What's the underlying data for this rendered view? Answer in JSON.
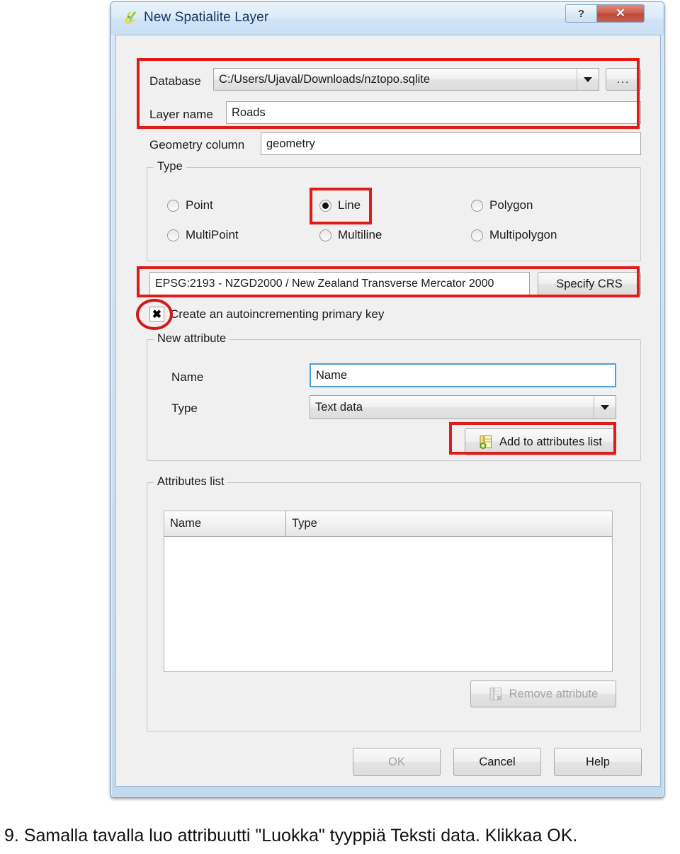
{
  "window": {
    "title": "New Spatialite Layer",
    "app_icon": "qgis-layer-icon",
    "help_button": "?",
    "close_button": "✕"
  },
  "form": {
    "database_label": "Database",
    "database_value": "C:/Users/Ujaval/Downloads/nztopo.sqlite",
    "browse_button": "...",
    "layer_name_label": "Layer name",
    "layer_name_value": "Roads",
    "geometry_column_label": "Geometry column",
    "geometry_column_value": "geometry"
  },
  "type_group": {
    "title": "Type",
    "options": [
      {
        "label": "Point",
        "checked": false
      },
      {
        "label": "Line",
        "checked": true
      },
      {
        "label": "Polygon",
        "checked": false
      },
      {
        "label": "MultiPoint",
        "checked": false
      },
      {
        "label": "Multiline",
        "checked": false
      },
      {
        "label": "Multipolygon",
        "checked": false
      }
    ]
  },
  "crs": {
    "value": "EPSG:2193 - NZGD2000 / New Zealand Transverse Mercator 2000",
    "specify_button": "Specify CRS"
  },
  "primary_key": {
    "label": "Create an autoincrementing primary key",
    "checked": true,
    "check_glyph": "✖"
  },
  "new_attribute": {
    "title": "New attribute",
    "name_label": "Name",
    "name_value": "Name",
    "type_label": "Type",
    "type_value": "Text data",
    "add_button": "Add to attributes list",
    "add_button_icon": "add-to-list-icon"
  },
  "attributes_list": {
    "title": "Attributes list",
    "columns": [
      "Name",
      "Type"
    ],
    "rows": [],
    "remove_button": "Remove attribute",
    "remove_button_icon": "remove-attribute-icon",
    "remove_enabled": false
  },
  "footer": {
    "ok": "OK",
    "ok_enabled": false,
    "cancel": "Cancel",
    "help": "Help"
  },
  "caption": {
    "text": "9. Samalla tavalla luo attribuutti \"Luokka\" tyyppiä Teksti data. Klikkaa OK."
  },
  "colors": {
    "annotation_red": "#e01b18",
    "focus_blue": "#4a9fe0",
    "close_red": "#bb4a3a",
    "title_text": "#17365d"
  }
}
